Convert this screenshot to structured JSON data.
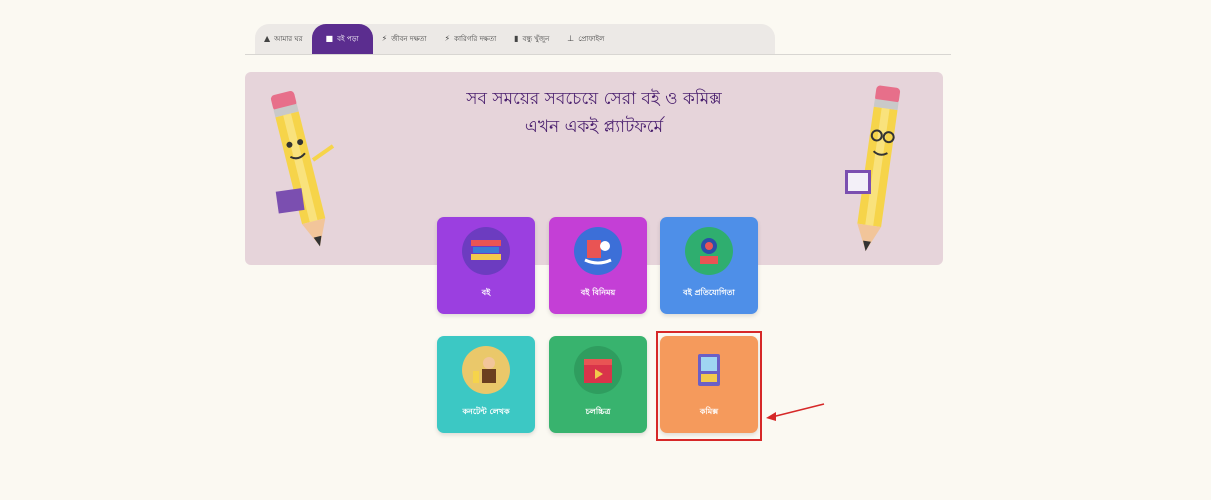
{
  "nav": {
    "tabs": [
      {
        "label": "আমার ঘর",
        "icon": "user-icon",
        "active": false
      },
      {
        "label": "বই পড়া",
        "icon": "book-icon",
        "active": true
      },
      {
        "label": "জীবন দক্ষতা",
        "icon": "skills-icon",
        "active": false
      },
      {
        "label": "কারিগরি দক্ষতা",
        "icon": "skills-icon",
        "active": false
      },
      {
        "label": "বন্ধু খুঁজুন",
        "icon": "list-icon",
        "active": false
      },
      {
        "label": "প্রোফাইল",
        "icon": "profile-icon",
        "active": false
      }
    ]
  },
  "banner": {
    "line1": "সব সময়ের সবচেয়ে সেরা বই ও কমিক্স",
    "line2": "এখন একই প্ল্যাটফর্মে"
  },
  "cards": [
    {
      "label": "বই",
      "icon": "books-icon",
      "color": "#9b3fe0"
    },
    {
      "label": "বই বিনিময়",
      "icon": "book-exchange-icon",
      "color": "#c43fd6"
    },
    {
      "label": "বই প্রতিযোগিতা",
      "icon": "trophy-icon",
      "color": "#4e8fe8"
    },
    {
      "label": "কনটেন্ট লেখক",
      "icon": "writer-icon",
      "color": "#3cc8c4"
    },
    {
      "label": "চলচ্চিত্র",
      "icon": "film-clapper-icon",
      "color": "#38b36e"
    },
    {
      "label": "কমিক্স",
      "icon": "comics-icon",
      "color": "#f59a5c"
    }
  ],
  "colors": {
    "accent": "#5b2d8f",
    "banner_bg": "#e6d4da",
    "highlight": "#d62828"
  }
}
